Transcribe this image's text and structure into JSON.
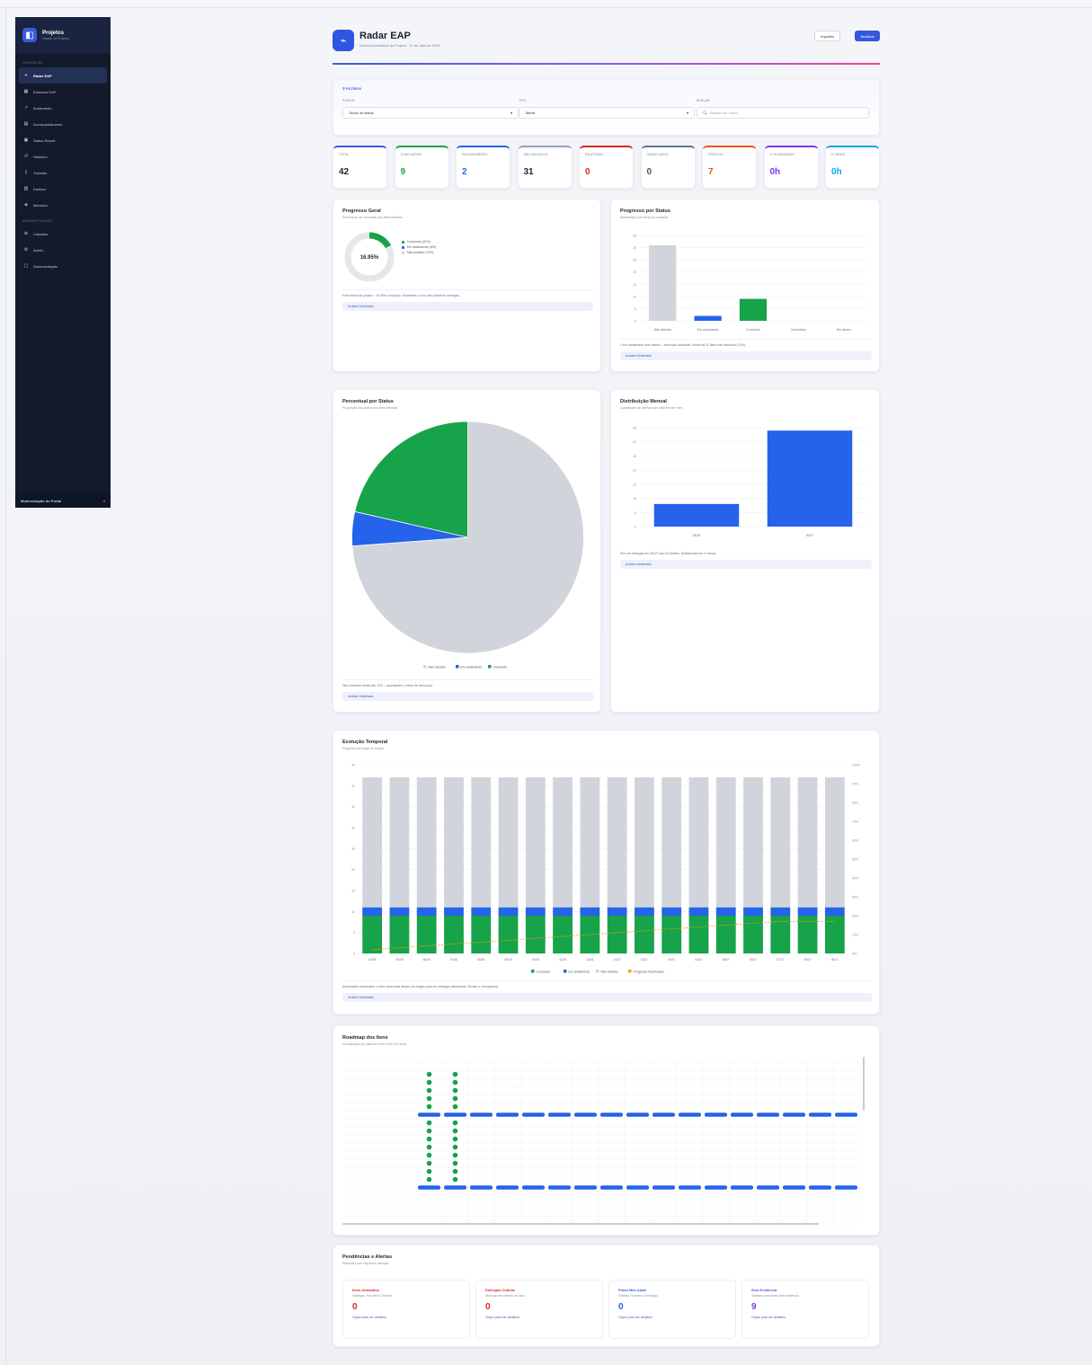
{
  "sidebar": {
    "app_title": "Projetos",
    "app_subtitle": "Gestão de Projetos",
    "section_main": "GERENCIAL",
    "items": [
      {
        "label": "Radar EAP",
        "icon": "radar-icon"
      },
      {
        "label": "Estrutura EAP",
        "icon": "grid-icon"
      },
      {
        "label": "Andamento",
        "icon": "trend-icon"
      },
      {
        "label": "Acompanhamento",
        "icon": "clipboard-icon"
      },
      {
        "label": "Status Report",
        "icon": "report-icon"
      },
      {
        "label": "Histórico",
        "icon": "history-icon"
      },
      {
        "label": "Tutoriais",
        "icon": "book-icon"
      },
      {
        "label": "Kanban",
        "icon": "kanban-icon"
      },
      {
        "label": "Memória",
        "icon": "memory-icon"
      }
    ],
    "section_admin": "ADMINISTRAÇÃO",
    "admin_items": [
      {
        "label": "Cadastro",
        "icon": "user-add-icon"
      },
      {
        "label": "Admin",
        "icon": "settings-icon"
      },
      {
        "label": "Documentação",
        "icon": "document-icon"
      }
    ],
    "footer_label": "Modernização do Portal",
    "footer_chevron": "»"
  },
  "header": {
    "title": "Radar EAP",
    "subtitle": "Estrutura Analítica do Projeto · 21 de abril de 2026",
    "export_label": "Importar",
    "refresh_label": "Atualizar"
  },
  "filters": {
    "heading": "FILTROS",
    "status_label": "STATUS",
    "status_value": "Todos os status",
    "type_label": "TIPO",
    "type_value": "Tarefa",
    "search_label": "BUSCAR",
    "search_placeholder": "Buscar por nome..."
  },
  "kpis": [
    {
      "label": "TOTAL",
      "value": "42",
      "color": "#3b5bdb",
      "val_color": "#1f2433"
    },
    {
      "label": "CONCLUÍDOS",
      "value": "9",
      "color": "#16a34a",
      "val_color": "#16a34a"
    },
    {
      "label": "EM ANDAMENTO",
      "value": "2",
      "color": "#2563eb",
      "val_color": "#2563eb"
    },
    {
      "label": "NÃO INICIADOS",
      "value": "31",
      "color": "#94a3b8",
      "val_color": "#1f2433"
    },
    {
      "label": "EM ATRASO",
      "value": "0",
      "color": "#dc2626",
      "val_color": "#dc2626"
    },
    {
      "label": "CANCELADOS",
      "value": "0",
      "color": "#64748b",
      "val_color": "#475569"
    },
    {
      "label": "CRÍTICOS",
      "value": "7",
      "color": "#ea580c",
      "val_color": "#ea580c"
    },
    {
      "label": "H. PLANEJADAS",
      "value": "0h",
      "color": "#7c3aed",
      "val_color": "#7c3aed"
    },
    {
      "label": "H. REAIS",
      "value": "0h",
      "color": "#0ea5e9",
      "val_color": "#0ea5e9"
    }
  ],
  "overall": {
    "title": "Progresso Geral",
    "subtitle": "Percentual de conclusão dos itens filtrados",
    "center": "16.95%",
    "legend": [
      "Concluído (21%)",
      "Em andamento (5%)",
      "Não iniciado (74%)"
    ],
    "insight": "Fase inicial do projeto · 16.95% concluído. Mantenha o foco nas primeiras entregas.",
    "analysis": "Análise Detalhada",
    "percent_complete": 16.95
  },
  "by_status": {
    "title": "Progresso por Status",
    "subtitle": "Distribuição dos itens por situação",
    "insight": "2 em andamento sem atraso – execução saudável. Ainda há 31 itens não iniciados (74%).",
    "analysis": "Análise Detalhada"
  },
  "pct_status": {
    "title": "Percentual por Status",
    "subtitle": "Proporção dos status nos itens filtrados",
    "insight": "Não iniciados ainda são 74% – acompanhe o ritmo de execução.",
    "analysis": "Análise Detalhada"
  },
  "monthly": {
    "title": "Distribuição Mensal",
    "subtitle": "Quantidade de tarefas com data fim por mês",
    "insight": "Pico de entregas em 06/27 com 34 tarefas. Distribuídas em 2 meses.",
    "analysis": "Análise Detalhada"
  },
  "temporal": {
    "title": "Evolução Temporal",
    "subtitle": "Progresso ao longo do tempo",
    "insight": "Aceleração necessária: o ritmo atual está abaixo do exigido para as entregas planejadas. Revise o cronograma.",
    "analysis": "Análise Detalhada"
  },
  "roadmap": {
    "title": "Roadmap dos Itens",
    "subtitle": "Visualização por data de início e fim (42 itens)"
  },
  "alerts": {
    "title": "Pendências e Alertas",
    "subtitle": "Situações que requerem atenção",
    "cards": [
      {
        "title": "Itens Atrasados",
        "sub": "Entregas, Pacotes e Tarefas",
        "value": "0",
        "color": "#dc2626",
        "link": "Clique para ver detalhes"
      },
      {
        "title": "Entregas Críticas",
        "sub": "Marcado em criterio de risco",
        "value": "0",
        "color": "#dc2626",
        "link": "Clique para ver detalhes"
      },
      {
        "title": "Prazo Mês Atual",
        "sub": "Tarefas, Pacotes e Entregas",
        "value": "0",
        "color": "#2563eb",
        "link": "Clique para ver detalhes"
      },
      {
        "title": "Sem Evidência",
        "sub": "Tarefas concluídas sem evidência",
        "value": "9",
        "color": "#7c3aed",
        "link": "Clique para ver detalhes"
      }
    ]
  },
  "chart_data": [
    {
      "type": "bar",
      "title": "Progresso por Status",
      "categories": [
        "Não iniciado",
        "Em andamento",
        "Concluído",
        "Cancelado",
        "Em atraso"
      ],
      "values": [
        31,
        2,
        9,
        0,
        0
      ],
      "colors": [
        "#d1d5db",
        "#2563eb",
        "#16a34a",
        "#9ca3af",
        "#dc2626"
      ],
      "yticks": [
        "35",
        "30",
        "25",
        "20",
        "15",
        "10",
        "5",
        "0"
      ],
      "ylim": [
        0,
        35
      ]
    },
    {
      "type": "pie",
      "title": "Percentual por Status",
      "categories": [
        "Não iniciado",
        "Em andamento",
        "Concluído"
      ],
      "values": [
        31,
        2,
        9
      ],
      "colors": [
        "#d1d5db",
        "#2563eb",
        "#16a34a"
      ],
      "legend": "bottom"
    },
    {
      "type": "bar",
      "title": "Distribuição Mensal",
      "categories": [
        "05/26",
        "06/27"
      ],
      "values": [
        8,
        34
      ],
      "colors": [
        "#2563eb",
        "#2563eb"
      ],
      "yticks": [
        "35",
        "30",
        "25",
        "20",
        "15",
        "10",
        "5",
        "0"
      ],
      "ylim": [
        0,
        35
      ]
    },
    {
      "type": "bar",
      "title": "Evolução Temporal",
      "stacked": true,
      "categories": [
        "04/26",
        "05/26",
        "06/26",
        "07/26",
        "08/26",
        "09/26",
        "10/26",
        "11/26",
        "12/26",
        "01/27",
        "02/27",
        "03/27",
        "04/27",
        "05/27",
        "06/27",
        "07/27",
        "08/27",
        "09/27"
      ],
      "series": [
        {
          "name": "Concluído",
          "values": [
            9,
            9,
            9,
            9,
            9,
            9,
            9,
            9,
            9,
            9,
            9,
            9,
            9,
            9,
            9,
            9,
            9,
            9
          ],
          "color": "#16a34a"
        },
        {
          "name": "Em andamento",
          "values": [
            2,
            2,
            2,
            2,
            2,
            2,
            2,
            2,
            2,
            2,
            2,
            2,
            2,
            2,
            2,
            2,
            2,
            2
          ],
          "color": "#2563eb"
        },
        {
          "name": "Não iniciado",
          "values": [
            31,
            31,
            31,
            31,
            31,
            31,
            31,
            31,
            31,
            31,
            31,
            31,
            31,
            31,
            31,
            31,
            31,
            31
          ],
          "color": "#d1d5db"
        },
        {
          "name": "Progresso Acumulado",
          "values": [
            2,
            3,
            4,
            5,
            6,
            7,
            8,
            9,
            10,
            11,
            12,
            13,
            14,
            15,
            16,
            17,
            17,
            17
          ],
          "color": "#f59e0b"
        }
      ],
      "yticks": [
        "45",
        "40",
        "35",
        "30",
        "25",
        "20",
        "15",
        "10",
        "5",
        "0"
      ],
      "y2ticks": [
        "100%",
        "90%",
        "80%",
        "70%",
        "60%",
        "50%",
        "40%",
        "30%",
        "20%",
        "10%",
        "0%"
      ],
      "ylim": [
        0,
        45
      ],
      "legend": "bottom"
    }
  ]
}
